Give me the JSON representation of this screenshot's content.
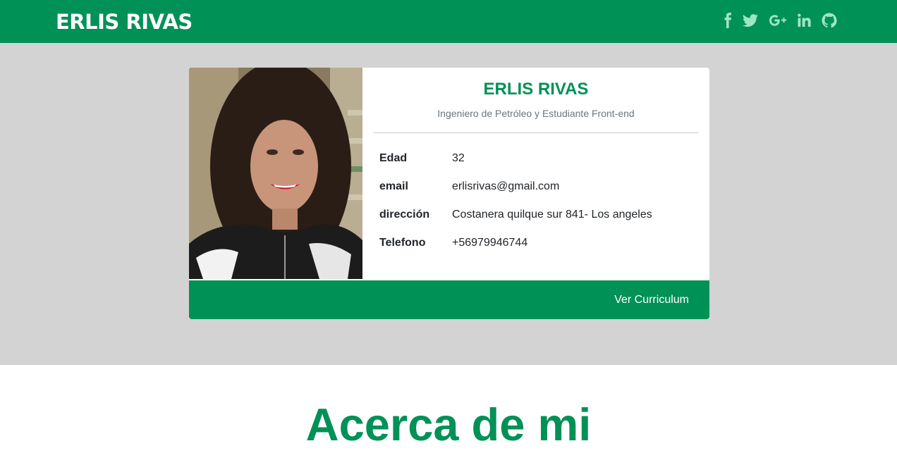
{
  "navbar": {
    "brand": "ERLIS RIVAS",
    "social": [
      {
        "icon": "facebook-icon"
      },
      {
        "icon": "twitter-icon"
      },
      {
        "icon": "google-plus-icon"
      },
      {
        "icon": "linkedin-icon"
      },
      {
        "icon": "github-icon"
      }
    ]
  },
  "profile": {
    "name": "ERLIS RIVAS",
    "subtitle": "Ingeniero de Petróleo y Estudiante Front-end",
    "fields": [
      {
        "label": "Edad",
        "value": "32"
      },
      {
        "label": "email",
        "value": "erlisrivas@gmail.com"
      },
      {
        "label": "dirección",
        "value": "Costanera quilque sur 841- Los angeles"
      },
      {
        "label": "Telefono",
        "value": "+56979946744"
      }
    ],
    "cv_button": "Ver Curriculum"
  },
  "about": {
    "heading": "Acerca de mi"
  },
  "colors": {
    "primary": "#009157",
    "hero_background": "#d3d3d3",
    "icon_color": "#9fe6c5"
  }
}
